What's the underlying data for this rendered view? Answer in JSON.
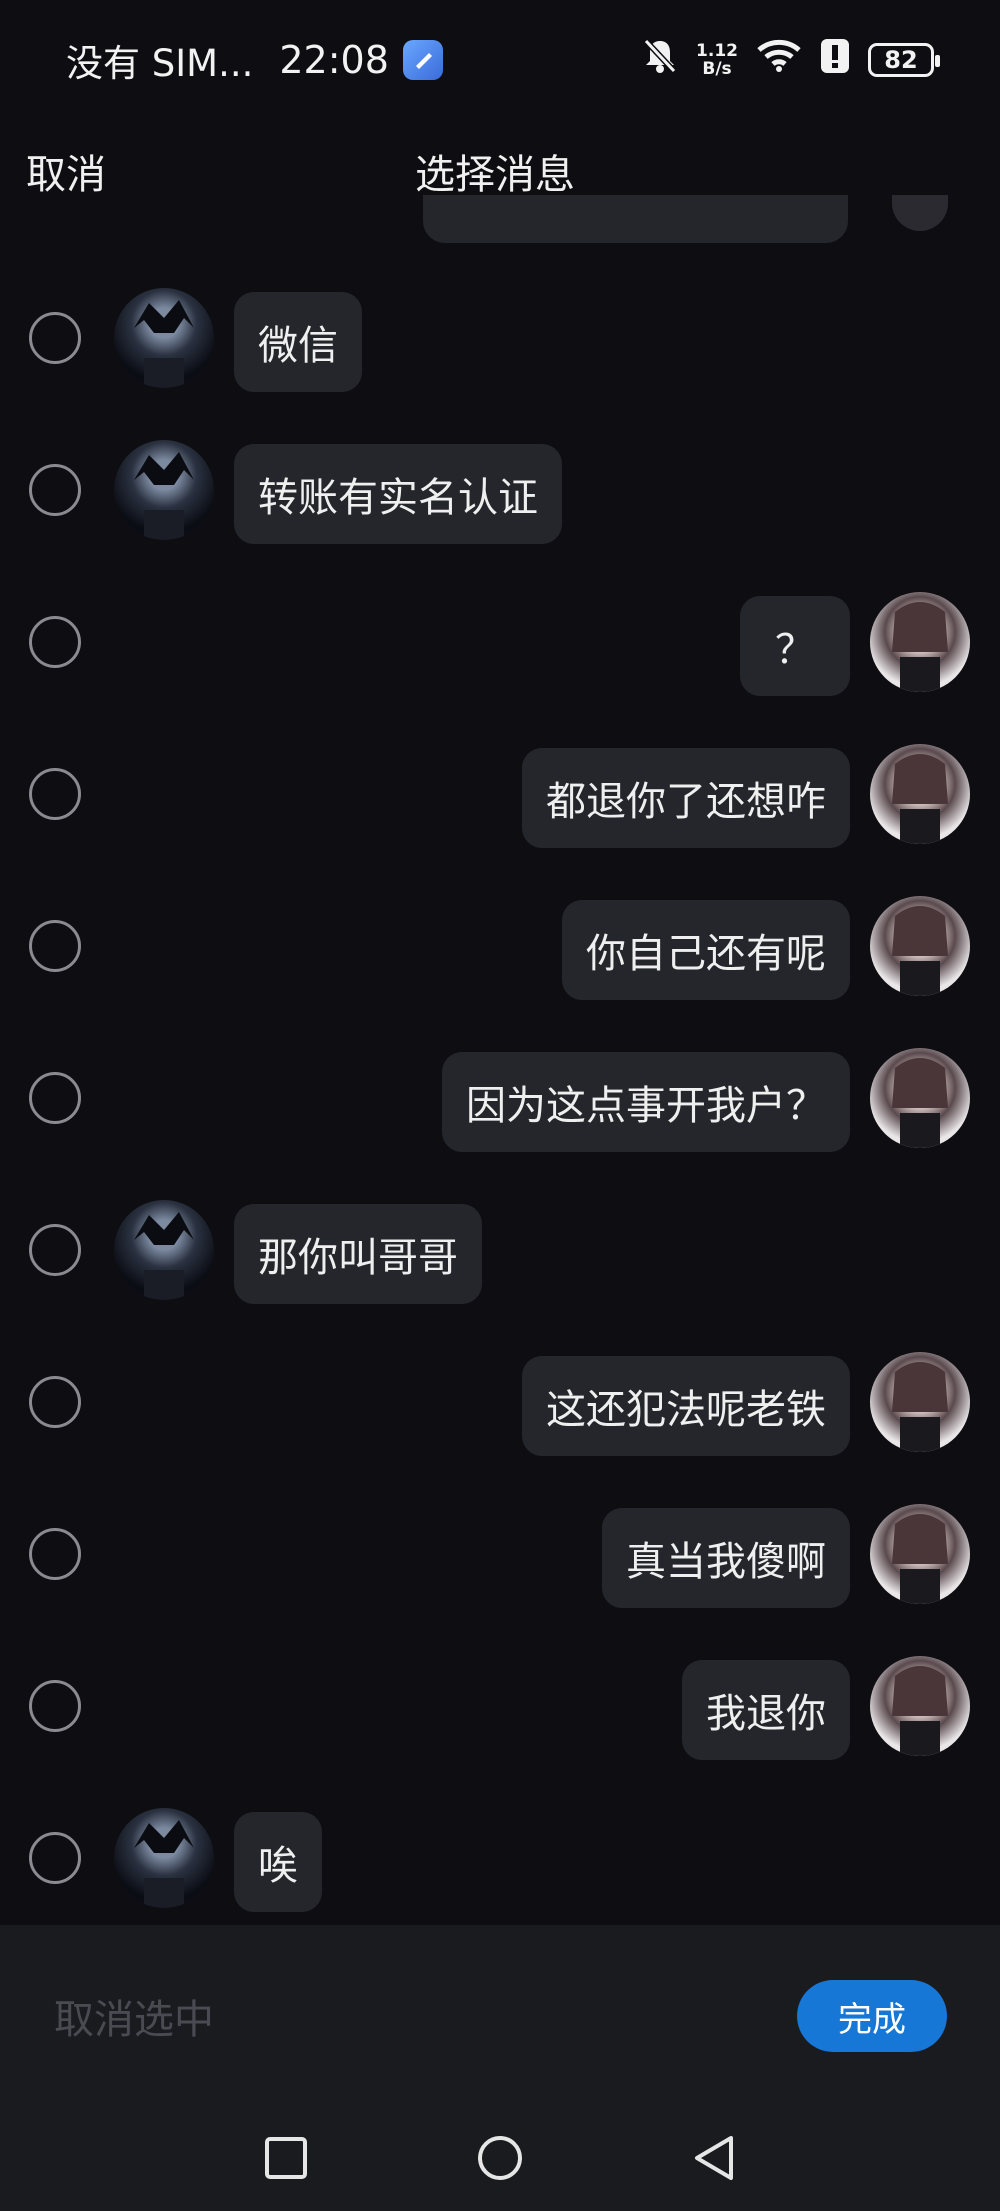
{
  "status_bar": {
    "carrier": "没有 SIM...",
    "time": "22:08",
    "net_speed_value": "1.12",
    "net_speed_unit": "B/s",
    "battery": "82"
  },
  "header": {
    "cancel_label": "取消",
    "title": "选择消息"
  },
  "messages": [
    {
      "sender": "them",
      "text": "微信"
    },
    {
      "sender": "them",
      "text": "转账有实名认证"
    },
    {
      "sender": "me",
      "text": "？"
    },
    {
      "sender": "me",
      "text": "都退你了还想咋"
    },
    {
      "sender": "me",
      "text": "你自己还有呢"
    },
    {
      "sender": "me",
      "text": "因为这点事开我户？"
    },
    {
      "sender": "them",
      "text": "那你叫哥哥"
    },
    {
      "sender": "me",
      "text": "这还犯法呢老铁"
    },
    {
      "sender": "me",
      "text": "真当我傻啊"
    },
    {
      "sender": "me",
      "text": "我退你"
    },
    {
      "sender": "them",
      "text": "唉"
    }
  ],
  "bottom_bar": {
    "unselect_label": "取消选中",
    "done_label": "完成"
  },
  "nav_bar": {
    "buttons": [
      "recent-apps",
      "home",
      "back"
    ]
  },
  "colors": {
    "background": "#0e0e12",
    "bubble": "#25262b",
    "accent": "#1677d6"
  }
}
